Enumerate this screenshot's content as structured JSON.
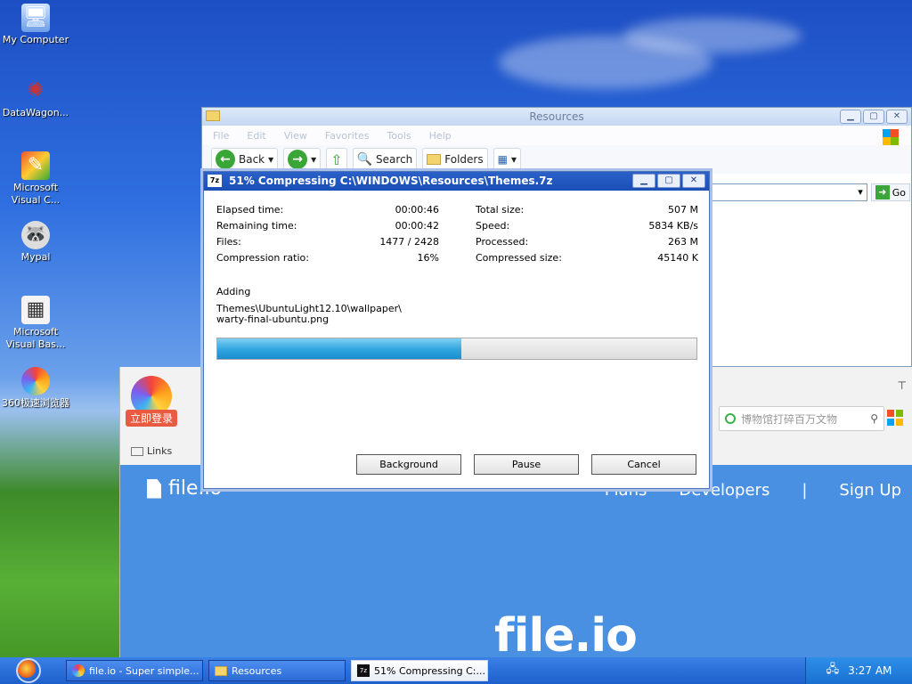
{
  "desktop": {
    "icons": [
      {
        "label": "My Computer",
        "icon": "computer-icon"
      },
      {
        "label": "DataWagon...",
        "icon": "datawagon-icon"
      },
      {
        "label": "Microsoft Visual C...",
        "icon": "visual-c-icon"
      },
      {
        "label": "Mypal",
        "icon": "mypal-icon"
      },
      {
        "label": "Microsoft Visual Bas...",
        "icon": "visual-basic-icon"
      },
      {
        "label": "360极速浏览器",
        "icon": "360-browser-icon"
      }
    ]
  },
  "explorer": {
    "title": "Resources",
    "menu": [
      "File",
      "Edit",
      "View",
      "Favorites",
      "Tools",
      "Help"
    ],
    "toolbar": {
      "back": "Back",
      "search": "Search",
      "folders": "Folders"
    },
    "go_label": "Go"
  },
  "browser": {
    "login_badge": "立即登录",
    "links_label": "Links",
    "search_placeholder": "博物馆打碎百万文物",
    "site": {
      "brand": "file.io",
      "nav": [
        "Plans",
        "Developers",
        "|",
        "Sign Up"
      ],
      "hero": "file.io"
    }
  },
  "dialog": {
    "title": "51% Compressing C:\\WINDOWS\\Resources\\Themes.7z",
    "app_icon": "7z",
    "left_stats": [
      {
        "key": "Elapsed time:",
        "value": "00:00:46"
      },
      {
        "key": "Remaining time:",
        "value": "00:00:42"
      },
      {
        "key": "Files:",
        "value": "1477 / 2428"
      },
      {
        "key": "Compression ratio:",
        "value": "16%"
      }
    ],
    "right_stats": [
      {
        "key": "Total size:",
        "value": "507 M"
      },
      {
        "key": "Speed:",
        "value": "5834 KB/s"
      },
      {
        "key": "Processed:",
        "value": "263 M"
      },
      {
        "key": "Compressed size:",
        "value": "45140 K"
      }
    ],
    "action": "Adding",
    "path_line1": "Themes\\UbuntuLight12.10\\wallpaper\\",
    "path_line2": "warty-final-ubuntu.png",
    "progress_percent": 51,
    "buttons": {
      "background": "Background",
      "pause": "Pause",
      "cancel": "Cancel"
    }
  },
  "taskbar": {
    "tasks": [
      {
        "label": "file.io - Super simple..."
      },
      {
        "label": "Resources"
      },
      {
        "label": "51% Compressing C:..."
      }
    ],
    "clock": "3:27 AM"
  }
}
